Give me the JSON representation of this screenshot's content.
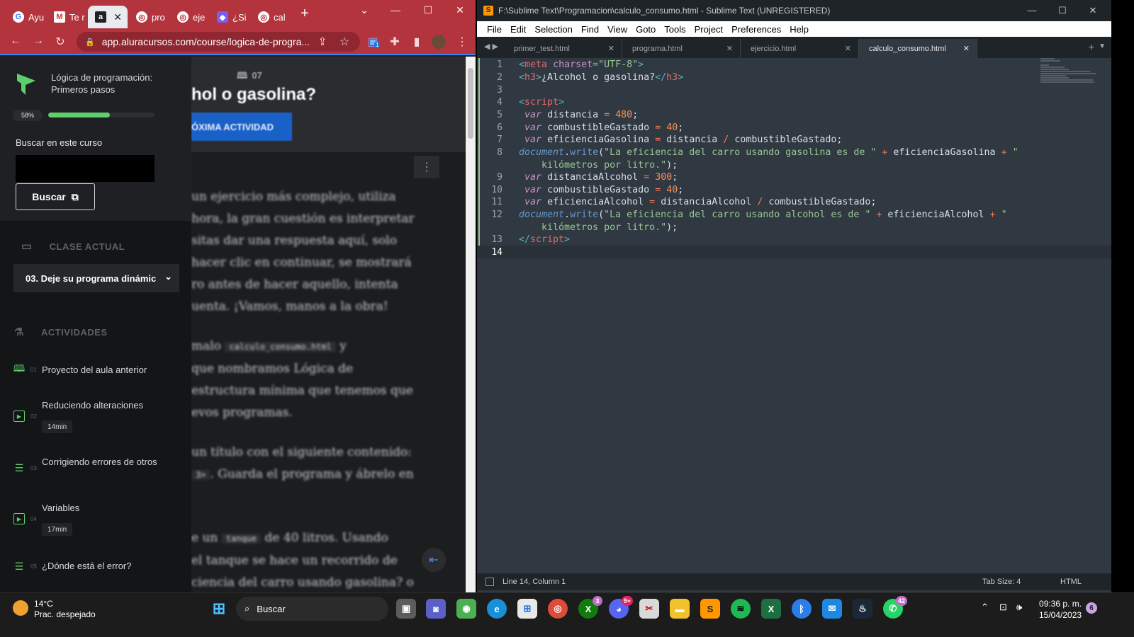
{
  "chrome": {
    "tabs": [
      {
        "label": "Ayu",
        "icon": "google-icon"
      },
      {
        "label": "Te r",
        "icon": "gmail-icon"
      },
      {
        "label": "",
        "icon": "alura-icon",
        "active": true
      },
      {
        "label": "pro",
        "icon": "globe-icon"
      },
      {
        "label": "eje",
        "icon": "globe-icon"
      },
      {
        "label": "¿Si",
        "icon": "app-icon"
      },
      {
        "label": "cal",
        "icon": "globe-icon"
      }
    ],
    "url": "app.aluracursos.com/course/logica-de-progra...",
    "extension_badge": "1",
    "accent": "#b3343d"
  },
  "course": {
    "title": "Lógica de programación: Primeros pasos",
    "progress": "58%",
    "progress_value": 0.58,
    "search_label": "Buscar en este curso",
    "search_button": "Buscar",
    "current_class_heading": "CLASE ACTUAL",
    "current_class": "03. Deje su programa dinámic",
    "activities_heading": "ACTIVIDADES",
    "activities": [
      {
        "num": "01",
        "title": "Proyecto del aula anterior",
        "time": "",
        "icon": "book-icon"
      },
      {
        "num": "02",
        "title": "Reduciendo alteraciones",
        "time": "14min",
        "icon": "video-icon"
      },
      {
        "num": "03",
        "title": "Corrigiendo errores de otros",
        "time": "",
        "icon": "list-icon"
      },
      {
        "num": "04",
        "title": "Variables",
        "time": "17min",
        "icon": "video-icon"
      },
      {
        "num": "05",
        "title": "¿Dónde está el error?",
        "time": "",
        "icon": "list-icon"
      }
    ]
  },
  "lesson": {
    "number": "07",
    "title": "hol o gasolina?",
    "next_button": "ÓXIMA ACTIVIDAD",
    "paragraphs": [
      "un ejercicio más complejo, utiliza",
      "hora, la gran cuestión es interpretar",
      "sitas dar una respuesta aquí, solo",
      "hacer clic en continuar, se mostrará",
      "ro antes de hacer aquello, intenta",
      "uenta. ¡Vamos, manos a la obra!",
      "",
      "malo",
      "que nombramos Lógica de",
      "estructura mínima que tenemos que",
      "evos programas.",
      "",
      "un título con el siguiente contenido:",
      ". Guarda el programa y ábrelo en",
      "",
      "",
      "e un",
      "el tanque se hace un recorrido de",
      "ciencia del carro usando gasolina? o"
    ],
    "code_snippet_1": "calculo_consumo.html",
    "after_snippet_1": " y",
    "code_snippet_2": "tanque",
    "after_snippet_2": " de 40 litros. Usando",
    "code_tag_fragment": "3>"
  },
  "sublime": {
    "title": "F:\\Sublime Text\\Programacion\\calculo_consumo.html - Sublime Text (UNREGISTERED)",
    "menu": [
      "File",
      "Edit",
      "Selection",
      "Find",
      "View",
      "Goto",
      "Tools",
      "Project",
      "Preferences",
      "Help"
    ],
    "tabs": [
      "primer_test.html",
      "programa.html",
      "ejercicio.html",
      "calculo_consumo.html"
    ],
    "active_tab": "calculo_consumo.html",
    "line_numbers": [
      "1",
      "2",
      "3",
      "4",
      "5",
      "6",
      "7",
      "8",
      "",
      "9",
      "10",
      "11",
      "12",
      "",
      "13",
      "14"
    ],
    "status": {
      "position": "Line 14, Column 1",
      "tab_size": "Tab Size: 4",
      "syntax": "HTML"
    }
  },
  "taskbar": {
    "weather_temp": "14°C",
    "weather_cond": "Prac. despejado",
    "search_placeholder": "Buscar",
    "xbox_badge": "3",
    "discord_badge": "9+",
    "whatsapp_badge": "42",
    "time": "09:36 p. m.",
    "date": "15/04/2023",
    "notifications": "6"
  }
}
